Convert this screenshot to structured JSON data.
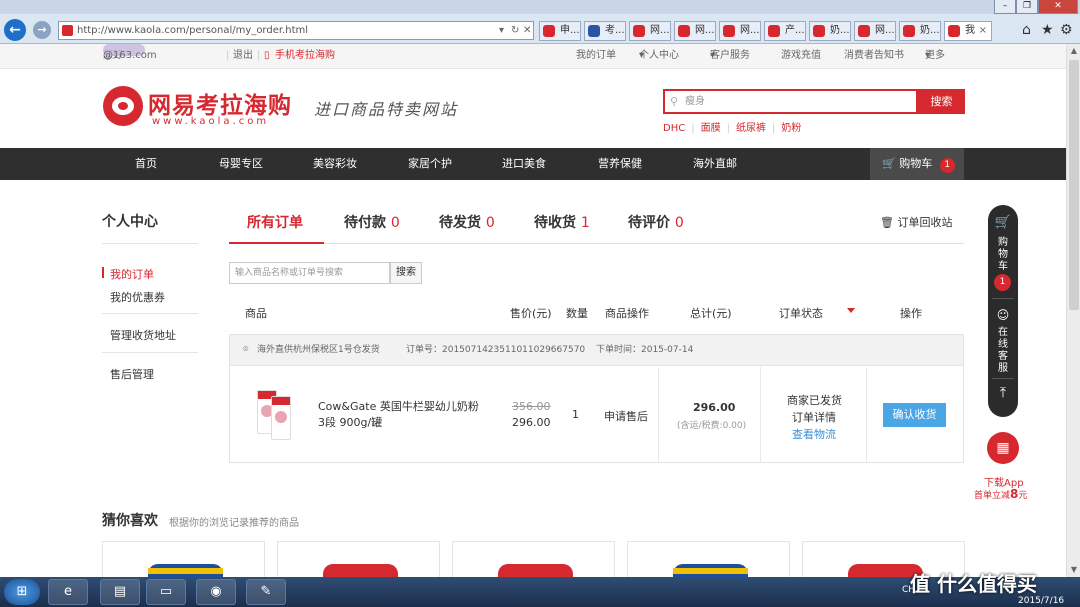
{
  "browser": {
    "url": "http://www.kaola.com/personal/my_order.html",
    "tabs": [
      "申...",
      "考...",
      "网...",
      "网...",
      "网...",
      "产...",
      "奶...",
      "网...",
      "奶...",
      "我"
    ],
    "active_tab_index": 9
  },
  "topbar": {
    "greeting": "您好",
    "email_suffix": "@163.com",
    "logout": "退出",
    "mobile": "手机考拉海购",
    "links": [
      "我的订单",
      "个人中心",
      "客户服务",
      "游戏充值",
      "消费者告知书",
      "更多"
    ]
  },
  "header": {
    "logo_text": "网易考拉海购",
    "logo_url": "www.kaola.com",
    "slogan": "进口商品特卖网站",
    "search_placeholder": "瘦身",
    "search_button": "搜索",
    "hotwords": [
      "DHC",
      "面膜",
      "纸尿裤",
      "奶粉"
    ]
  },
  "nav": {
    "items": [
      "首页",
      "母婴专区",
      "美容彩妆",
      "家居个护",
      "进口美食",
      "营养保健",
      "海外直邮"
    ],
    "cart_label": "购物车",
    "cart_count": "1"
  },
  "sidebar": {
    "title": "个人中心",
    "items": [
      "我的订单",
      "我的优惠券",
      "管理收货地址",
      "售后管理"
    ]
  },
  "tabs": [
    {
      "label": "所有订单",
      "count": ""
    },
    {
      "label": "待付款",
      "count": "0"
    },
    {
      "label": "待发货",
      "count": "0"
    },
    {
      "label": "待收货",
      "count": "1"
    },
    {
      "label": "待评价",
      "count": "0"
    }
  ],
  "recycle_bin": "订单回收站",
  "order_search": {
    "placeholder": "输入商品名称或订单号搜索",
    "button": "搜索"
  },
  "table_header": [
    "商品",
    "售价(元)",
    "数量",
    "商品操作",
    "总计(元)",
    "订单状态",
    "操作"
  ],
  "order": {
    "warehouse": "海外直供杭州保税区1号仓发货",
    "order_no": "订单号：20150714235110110296675​70",
    "order_time": "下单时间：2015-07-14",
    "product_name": "Cow&Gate 英国牛栏婴幼儿奶粉 3段 900g/罐",
    "original_price": "356.00",
    "price": "296.00",
    "quantity": "1",
    "product_action": "申请售后",
    "total": "296.00",
    "total_note": "(含运/税费:0.00)",
    "status": "商家已发货",
    "detail_link": "订单详情",
    "logistics_link": "查看物流",
    "action_button": "确认收货"
  },
  "recommend": {
    "title": "猜你喜欢",
    "subtitle": "根据你的浏览记录推荐的商品"
  },
  "float_bar": {
    "cart": "购物车",
    "cart_count": "1",
    "service": "在线客服",
    "download": "下载App",
    "promo_prefix": "首单立减",
    "promo_amount": "8",
    "promo_unit": "元"
  },
  "taskbar": {
    "tray_text": "CH",
    "watermark": "值 什么值得买",
    "date": "2015/7/16"
  },
  "colors": {
    "brand": "#d6282f",
    "nav_bg": "#2f2f2f",
    "link_blue": "#3a8fd6",
    "button_blue": "#4ba6e6"
  }
}
